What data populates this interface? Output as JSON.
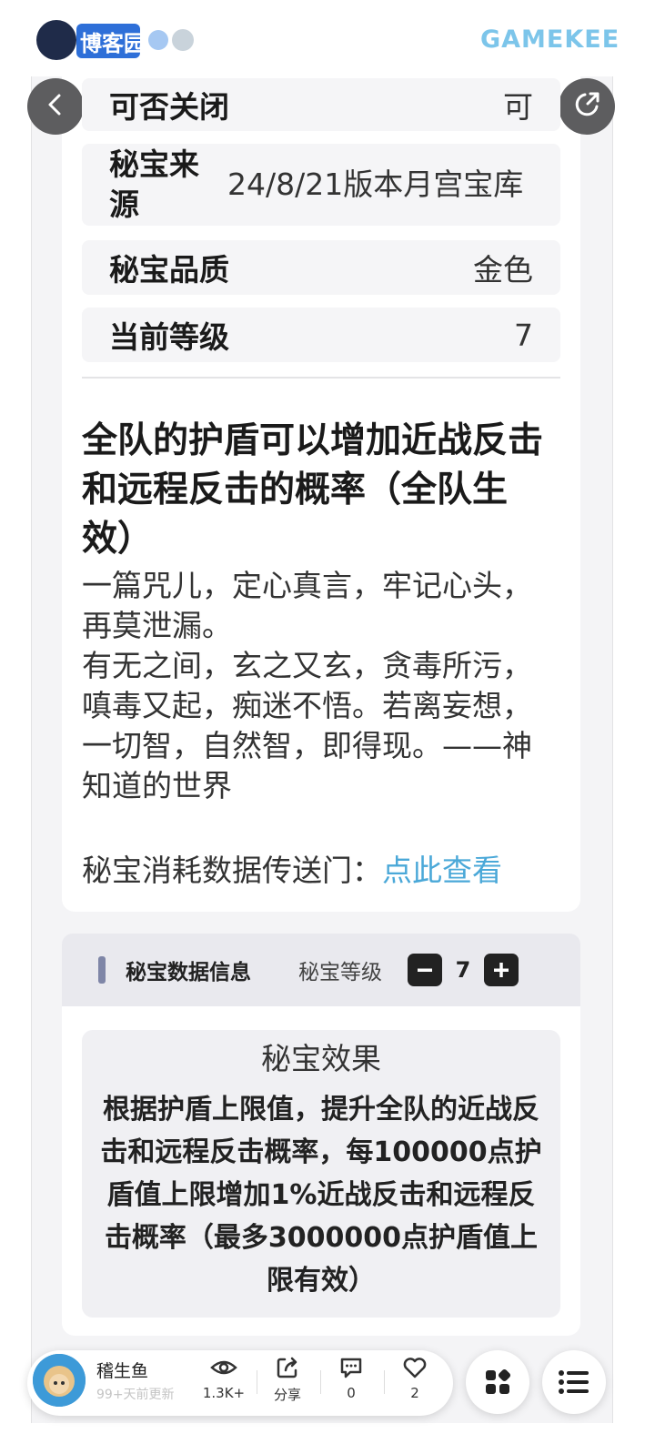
{
  "header": {
    "logo_text": "博客园",
    "right_logo_text": "GAMEKEE"
  },
  "info": {
    "closable_label": "可否关闭",
    "closable_value": "可",
    "source_label": "秘宝来源",
    "source_value": "24/8/21版本月宫宝库",
    "quality_label": "秘宝品质",
    "quality_value": "金色",
    "level_label": "当前等级",
    "level_value": "7"
  },
  "headline": "全队的护盾可以增加近战反击和远程反击的概率（全队生效）",
  "flavor_text": "一篇咒儿，定心真言，牢记心头，再莫泄漏。\n有无之间，玄之又玄，贪毒所污，嗔毒又起，痴迷不悟。若离妄想，一切智，自然智，即得现。——神知道的世界",
  "portal": {
    "label": "秘宝消耗数据传送门：",
    "link": "点此查看"
  },
  "data_section": {
    "title": "秘宝数据信息",
    "level_label": "秘宝等级",
    "level_value": "7",
    "effect_title": "秘宝效果",
    "effect_desc": "根据护盾上限值，提升全队的近战反击和远程反击概率，每100000点护盾值上限增加1%近战反击和远程反击概率（最多3000000点护盾值上限有效）"
  },
  "bottom_bar": {
    "author": "稽生鱼",
    "update": "99+天前更新",
    "views": "1.3K+",
    "share": "分享",
    "comments": "0",
    "likes": "2"
  },
  "icons": [
    "back-icon",
    "share-external-icon",
    "eye-icon",
    "share-icon",
    "comment-icon",
    "heart-icon",
    "grid-icon",
    "list-icon"
  ]
}
